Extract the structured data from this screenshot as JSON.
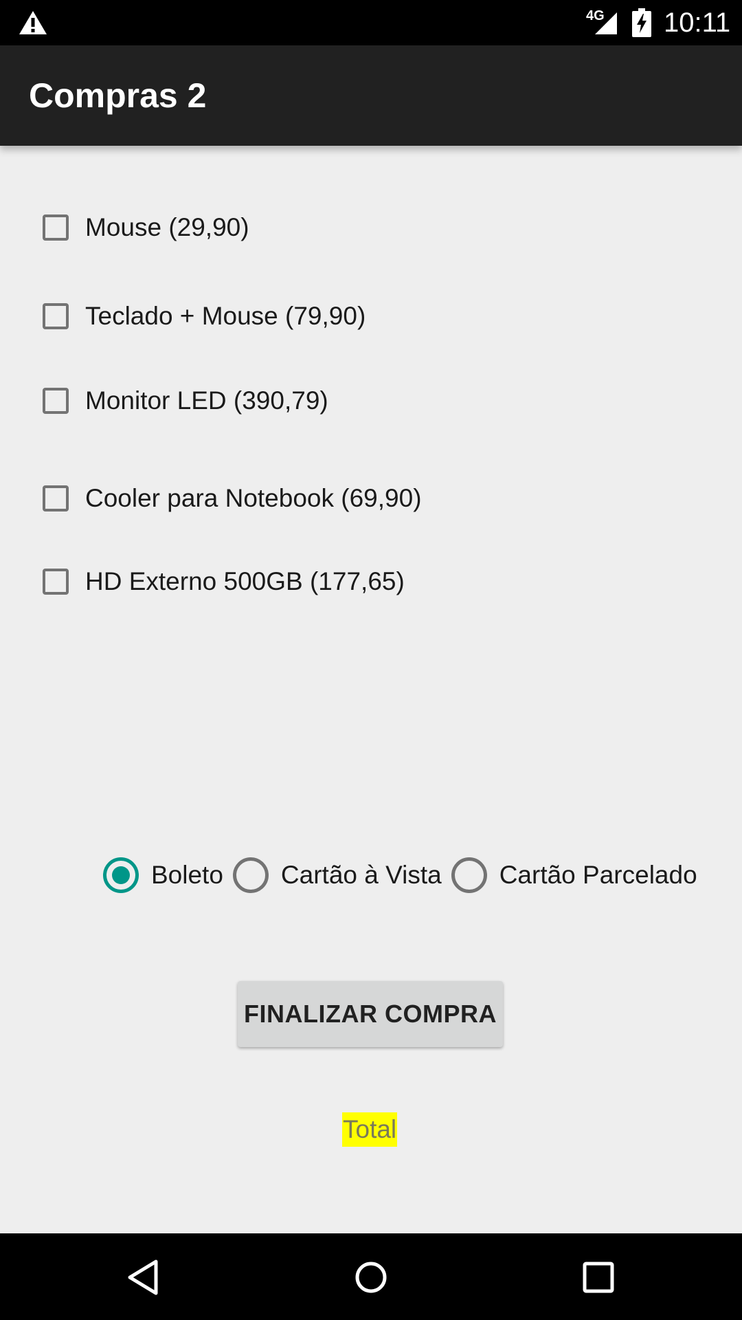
{
  "status_bar": {
    "network": "4G",
    "time": "10:11",
    "icons": [
      "warning-icon",
      "signal-icon",
      "battery-charging-icon"
    ]
  },
  "app_bar": {
    "title": "Compras 2"
  },
  "products": [
    {
      "label": "Mouse (29,90)",
      "checked": false
    },
    {
      "label": "Teclado + Mouse (79,90)",
      "checked": false
    },
    {
      "label": "Monitor LED (390,79)",
      "checked": false
    },
    {
      "label": "Cooler para Notebook (69,90)",
      "checked": false
    },
    {
      "label": "HD Externo 500GB (177,65)",
      "checked": false
    }
  ],
  "payment_options": [
    {
      "label": "Boleto",
      "selected": true
    },
    {
      "label": "Cartão à Vista",
      "selected": false
    },
    {
      "label": "Cartão Parcelado",
      "selected": false
    }
  ],
  "finish_button": {
    "label": "FINALIZAR COMPRA"
  },
  "total": {
    "label": "Total",
    "highlight_color": "#ffff00"
  },
  "colors": {
    "accent": "#009688",
    "app_bar": "#212121",
    "background": "#eeeeee"
  },
  "nav_bar": {
    "icons": [
      "back-icon",
      "home-icon",
      "recents-icon"
    ]
  }
}
